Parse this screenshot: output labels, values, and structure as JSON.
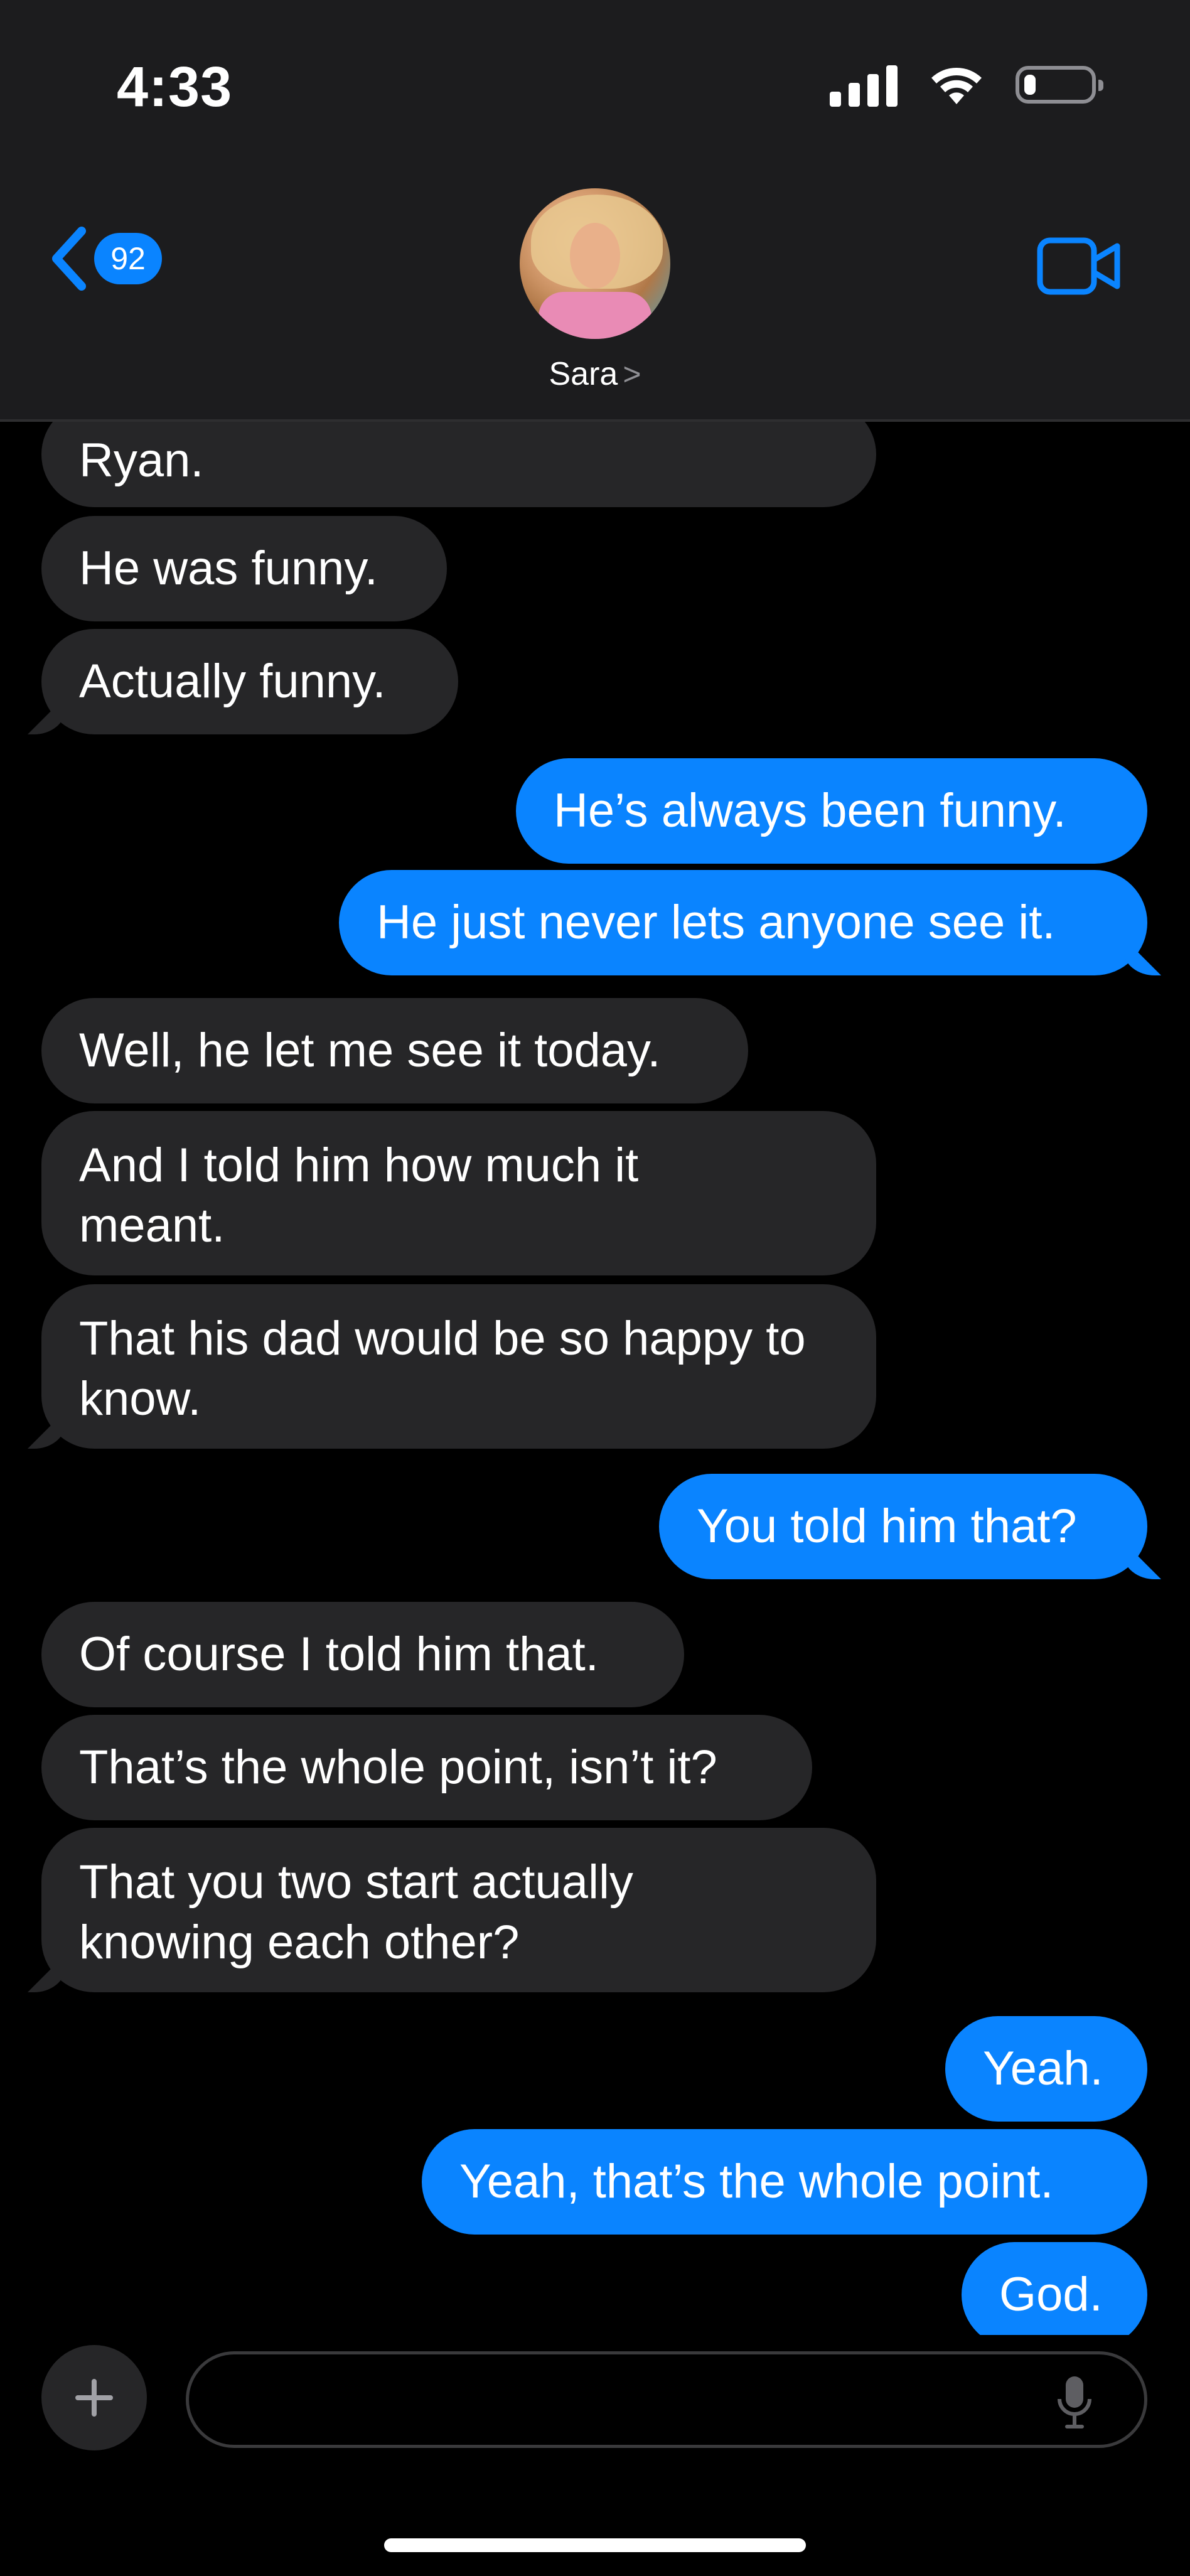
{
  "status_bar": {
    "time": "4:33",
    "battery_level": 0.18,
    "signal_bars": 4
  },
  "header": {
    "back_badge_count": "92",
    "contact_name": "Sara",
    "contact_chevron": ">",
    "icons": {
      "back": "chevron-left-icon",
      "video": "video-camera-icon"
    }
  },
  "messages": [
    {
      "side": "incoming",
      "text": "Ryan."
    },
    {
      "side": "incoming",
      "text": "He was funny."
    },
    {
      "side": "incoming",
      "text": "Actually funny."
    },
    {
      "side": "outgoing",
      "text": "He’s always been funny."
    },
    {
      "side": "outgoing",
      "text": "He just never lets anyone see it."
    },
    {
      "side": "incoming",
      "text": "Well, he let me see it today."
    },
    {
      "side": "incoming",
      "text": "And I told him how much it meant."
    },
    {
      "side": "incoming",
      "text": "That his dad would be so happy to know."
    },
    {
      "side": "outgoing",
      "text": "You told him that?"
    },
    {
      "side": "incoming",
      "text": "Of course I told him that."
    },
    {
      "side": "incoming",
      "text": "That’s the whole point, isn’t it?"
    },
    {
      "side": "incoming",
      "text": "That you two start actually knowing each other?"
    },
    {
      "side": "outgoing",
      "text": "Yeah."
    },
    {
      "side": "outgoing",
      "text": "Yeah, that’s the whole point."
    },
    {
      "side": "outgoing",
      "text": "God."
    }
  ],
  "composer": {
    "placeholder": "",
    "value": "",
    "icons": {
      "add": "plus-icon",
      "dictation": "microphone-icon"
    }
  },
  "colors": {
    "accent": "#0a84ff",
    "incoming_bubble": "#262628",
    "header_bg": "#1c1c1e",
    "background": "#000000"
  }
}
